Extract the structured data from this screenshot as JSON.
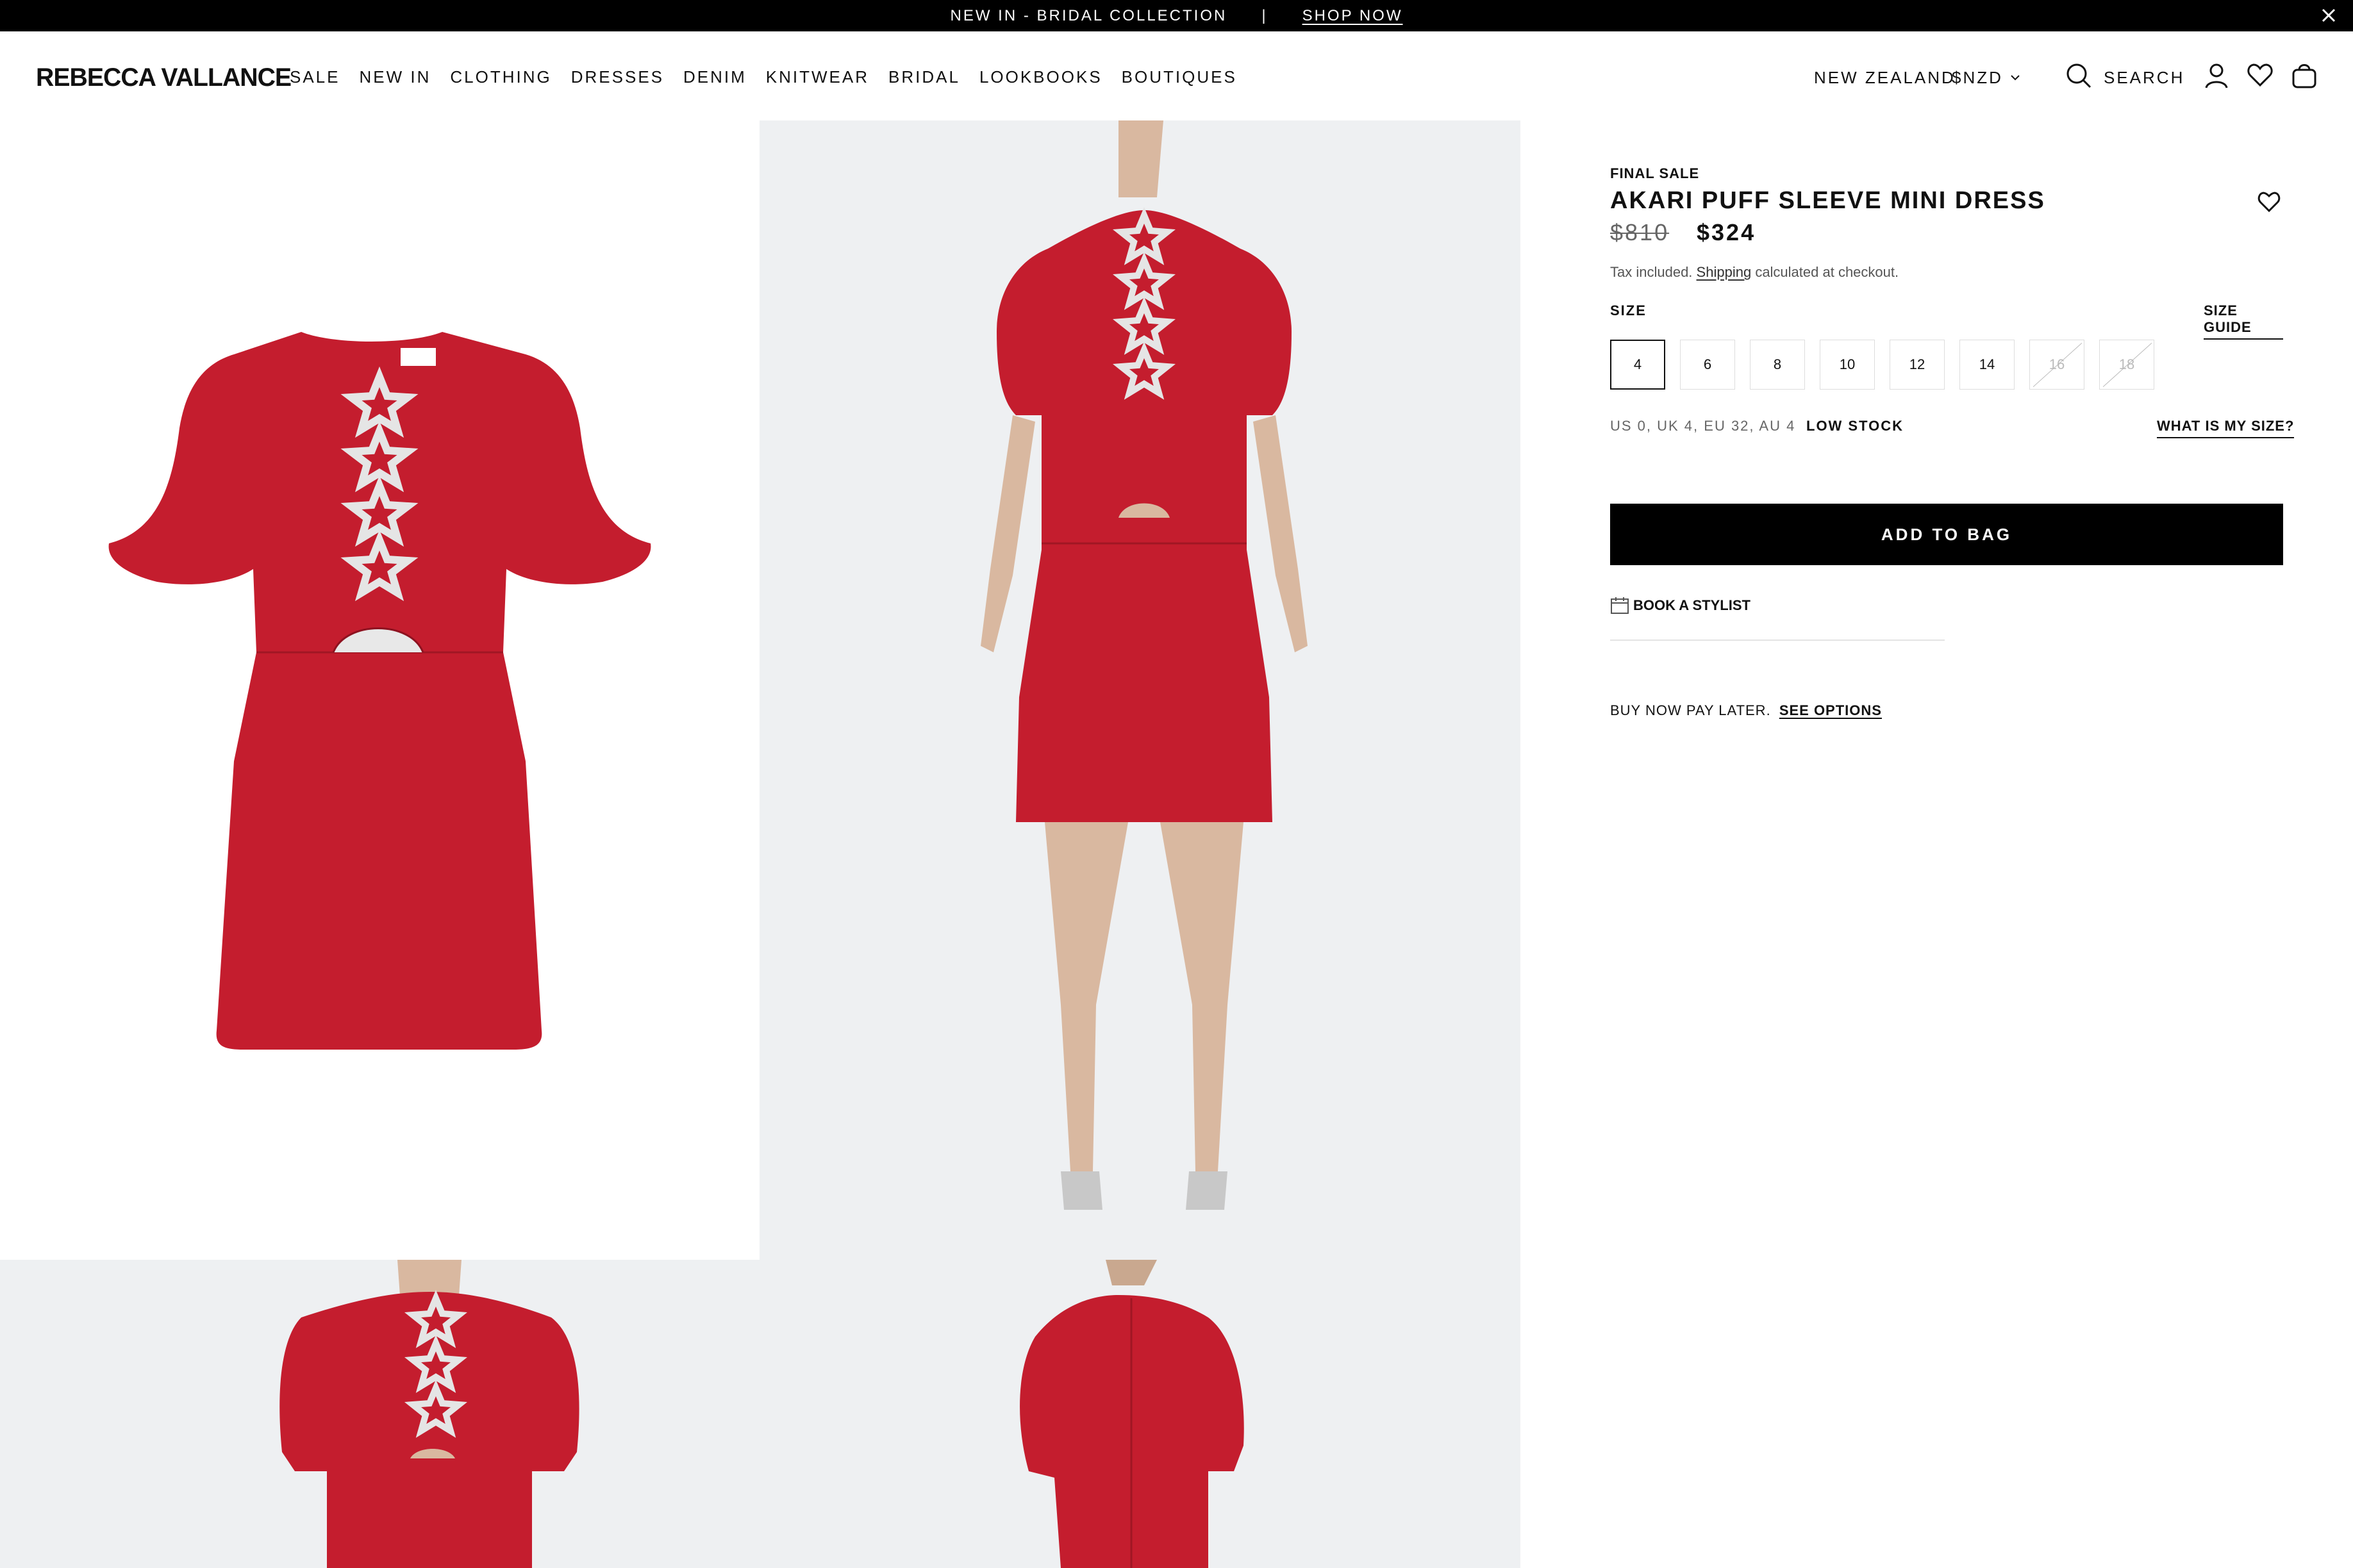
{
  "announcement": {
    "text": "NEW IN - BRIDAL COLLECTION",
    "separator": "|",
    "link": "SHOP NOW"
  },
  "header": {
    "logo": "REBECCA VALLANCE",
    "nav": [
      "SALE",
      "NEW IN",
      "CLOTHING",
      "DRESSES",
      "DENIM",
      "KNITWEAR",
      "BRIDAL",
      "LOOKBOOKS",
      "BOUTIQUES"
    ],
    "country": "NEW ZEALAND",
    "currency": "$NZD",
    "search_label": "SEARCH"
  },
  "product": {
    "badge": "FINAL SALE",
    "title": "AKARI PUFF SLEEVE MINI DRESS",
    "price_old": "$810",
    "price_new": "$324",
    "tax_prefix": "Tax included.",
    "tax_link": "Shipping",
    "tax_suffix": "calculated at checkout.",
    "size_label": "SIZE",
    "size_guide": "SIZE GUIDE",
    "sizes": [
      {
        "label": "4",
        "state": "selected"
      },
      {
        "label": "6",
        "state": "available"
      },
      {
        "label": "8",
        "state": "available"
      },
      {
        "label": "10",
        "state": "available"
      },
      {
        "label": "12",
        "state": "available"
      },
      {
        "label": "14",
        "state": "available"
      },
      {
        "label": "16",
        "state": "unavailable"
      },
      {
        "label": "18",
        "state": "unavailable"
      }
    ],
    "size_conversion": "US 0, UK 4, EU 32, AU 4",
    "stock_status": "LOW STOCK",
    "what_size": "WHAT IS MY SIZE?",
    "add_to_bag": "ADD TO BAG",
    "book_stylist": "BOOK A STYLIST",
    "bnpl_text": "BUY NOW PAY LATER.",
    "bnpl_link": "SEE OPTIONS"
  },
  "colors": {
    "dress_red": "#c41d2e",
    "accent": "#000000",
    "gallery_bg": "#eef0f2"
  }
}
